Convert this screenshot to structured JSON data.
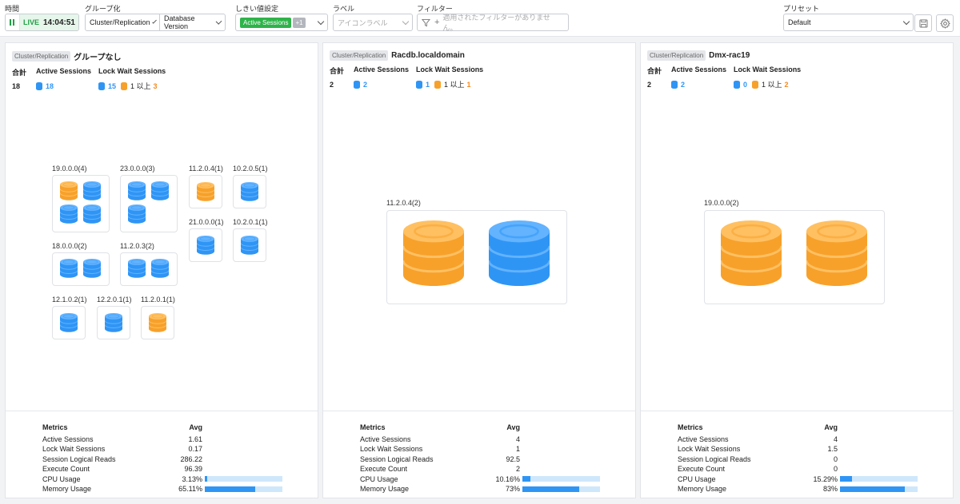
{
  "toolbar": {
    "time_label": "時間",
    "live_label": "LIVE",
    "live_time": "14:04:51",
    "group_label": "グループ化",
    "group_select1": "Cluster/Replication",
    "group_select2": "Database Version",
    "threshold_label": "しきい値設定",
    "threshold_badge": "Active Sessions",
    "threshold_count": "+1",
    "label_label": "ラベル",
    "label_placeholder": "アイコンラベル",
    "filter_label": "フィルター",
    "filter_placeholder": "適用されたフィルターがありません。",
    "preset_label": "プリセット",
    "preset_value": "Default"
  },
  "panels": [
    {
      "tag": "Cluster/Replication",
      "name": "グループなし",
      "total_header": "合計",
      "active_header": "Active Sessions",
      "lock_header": "Lock Wait Sessions",
      "total": "18",
      "active": "18",
      "lock_normal": "15",
      "lock_text": "1 以上",
      "lock_alert": "3",
      "groups": [
        "19.0.0.0(4)",
        "23.0.0.0(3)",
        "11.2.0.4(1)",
        "10.2.0.5(1)",
        "18.0.0.0(2)",
        "11.2.0.3(2)",
        "21.0.0.0(1)",
        "10.2.0.1(1)",
        "12.1.0.2(1)",
        "12.2.0.1(1)",
        "11.2.0.1(1)"
      ],
      "metrics_header": "Metrics",
      "avg_header": "Avg",
      "metrics": [
        {
          "name": "Active Sessions",
          "avg": "1.61"
        },
        {
          "name": "Lock Wait Sessions",
          "avg": "0.17"
        },
        {
          "name": "Session Logical Reads",
          "avg": "286.22"
        },
        {
          "name": "Execute Count",
          "avg": "96.39"
        },
        {
          "name": "CPU Usage",
          "avg": "3.13%",
          "pct": 3.13
        },
        {
          "name": "Memory Usage",
          "avg": "65.11%",
          "pct": 65.11
        }
      ]
    },
    {
      "tag": "Cluster/Replication",
      "name": "Racdb.localdomain",
      "total_header": "合計",
      "active_header": "Active Sessions",
      "lock_header": "Lock Wait Sessions",
      "total": "2",
      "active": "2",
      "lock_normal": "1",
      "lock_text": "1 以上",
      "lock_alert": "1",
      "groups": [
        "11.2.0.4(2)"
      ],
      "metrics_header": "Metrics",
      "avg_header": "Avg",
      "metrics": [
        {
          "name": "Active Sessions",
          "avg": "4"
        },
        {
          "name": "Lock Wait Sessions",
          "avg": "1"
        },
        {
          "name": "Session Logical Reads",
          "avg": "92.5"
        },
        {
          "name": "Execute Count",
          "avg": "2"
        },
        {
          "name": "CPU Usage",
          "avg": "10.16%",
          "pct": 10.16
        },
        {
          "name": "Memory Usage",
          "avg": "73%",
          "pct": 73
        }
      ]
    },
    {
      "tag": "Cluster/Replication",
      "name": "Dmx-rac19",
      "total_header": "合計",
      "active_header": "Active Sessions",
      "lock_header": "Lock Wait Sessions",
      "total": "2",
      "active": "2",
      "lock_normal": "0",
      "lock_text": "1 以上",
      "lock_alert": "2",
      "groups": [
        "19.0.0.0(2)"
      ],
      "metrics_header": "Metrics",
      "avg_header": "Avg",
      "metrics": [
        {
          "name": "Active Sessions",
          "avg": "4"
        },
        {
          "name": "Lock Wait Sessions",
          "avg": "1.5"
        },
        {
          "name": "Session Logical Reads",
          "avg": "0"
        },
        {
          "name": "Execute Count",
          "avg": "0"
        },
        {
          "name": "CPU Usage",
          "avg": "15.29%",
          "pct": 15.29
        },
        {
          "name": "Memory Usage",
          "avg": "83%",
          "pct": 83
        }
      ]
    }
  ],
  "colors": {
    "normal": "#2f95f5",
    "alert": "#f7a12b",
    "live": "#21a047"
  }
}
